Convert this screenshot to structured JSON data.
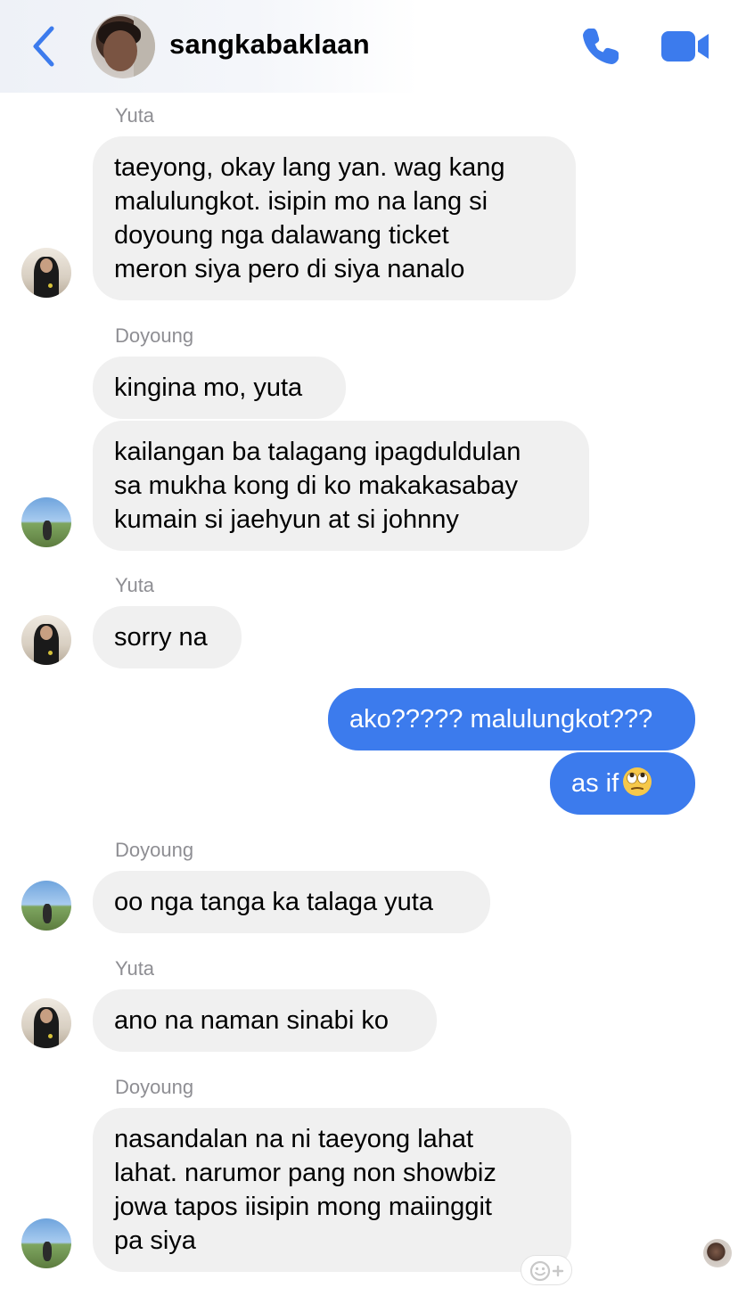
{
  "header": {
    "title": "sangkabaklaan",
    "back_icon": "chevron-left-icon",
    "call_icon": "phone-icon",
    "video_icon": "video-camera-icon",
    "accent_color": "#3c7bed"
  },
  "messages": [
    {
      "sender": "Yuta",
      "bubbles": [
        "taeyong, okay lang yan. wag kang\nmalulungkot. isipin mo na lang si\ndoyoung nga dalawang ticket\nmeron siya pero di siya nanalo"
      ]
    },
    {
      "sender": "Doyoung",
      "bubbles": [
        "kingina mo, yuta",
        "kailangan ba talagang ipagduldulan\nsa mukha kong di ko makakasabay\nkumain si jaehyun at si johnny"
      ]
    },
    {
      "sender": "Yuta",
      "bubbles": [
        "sorry na"
      ]
    },
    {
      "sender": "me",
      "bubbles": [
        "ako????? malulungkot???",
        "as if"
      ]
    },
    {
      "sender": "Doyoung",
      "bubbles": [
        "oo nga tanga ka talaga yuta"
      ]
    },
    {
      "sender": "Yuta",
      "bubbles": [
        "ano na naman sinabi ko"
      ]
    },
    {
      "sender": "Doyoung",
      "bubbles": [
        "nasandalan na ni taeyong lahat\nlahat. narumor pang non showbiz\njowa tapos iisipin mong maiinggit\npa siya"
      ]
    }
  ],
  "colors": {
    "incoming_bubble": "#f0f0f0",
    "outgoing_bubble": "#3c7bed",
    "sender_label": "#8e8e93"
  },
  "emoji": "face-with-rolling-eyes-icon",
  "reaction_icon": "add-reaction-icon"
}
